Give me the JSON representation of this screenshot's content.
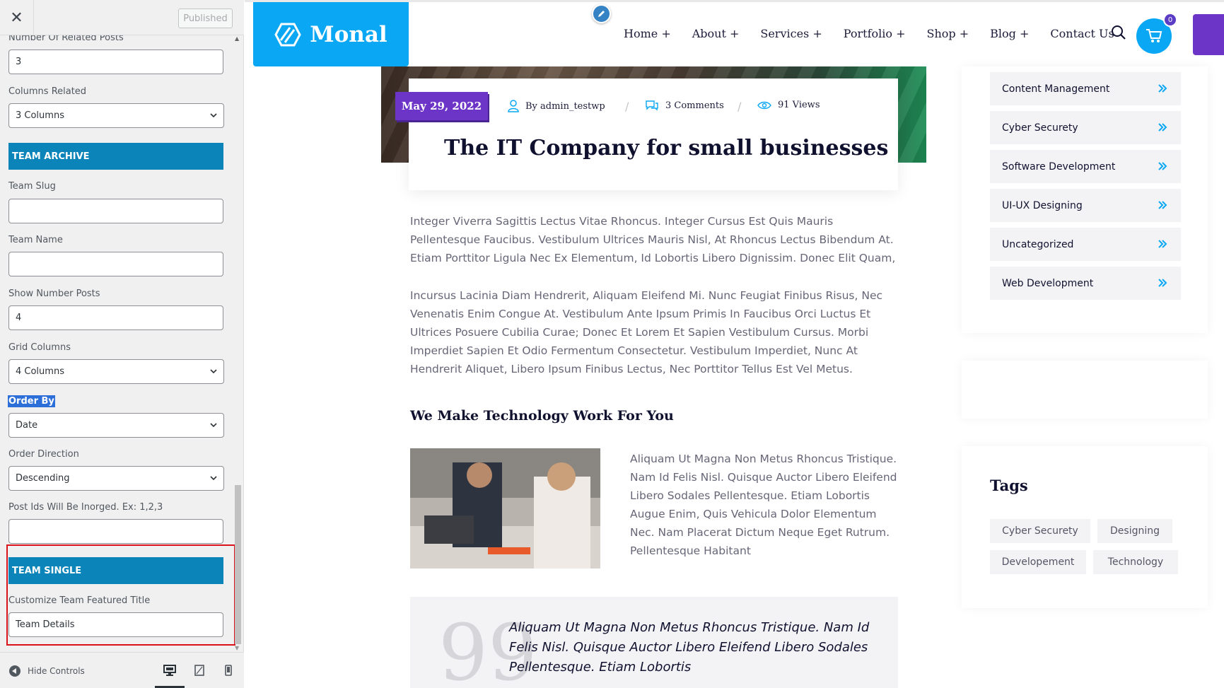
{
  "panel": {
    "close_glyph": "✕",
    "publish_label": "Published",
    "fields": {
      "related_posts_label": "Number Of Related Posts",
      "related_posts_value": "3",
      "columns_related_label": "Columns Related",
      "columns_related_value": "3 Columns",
      "team_archive_heading": "TEAM ARCHIVE",
      "team_slug_label": "Team Slug",
      "team_slug_value": "",
      "team_name_label": "Team Name",
      "team_name_value": "",
      "show_number_posts_label": "Show Number Posts",
      "show_number_posts_value": "4",
      "grid_columns_label": "Grid Columns",
      "grid_columns_value": "4 Columns",
      "order_by_label": "Order By",
      "order_by_value": "Date",
      "order_direction_label": "Order Direction",
      "order_direction_value": "Descending",
      "post_ids_label": "Post Ids Will Be Inorged. Ex: 1,2,3",
      "post_ids_value": "",
      "team_single_heading": "TEAM SINGLE",
      "featured_title_label": "Customize Team Featured Title",
      "featured_title_value": "Team Details"
    },
    "footer": {
      "hide_controls_label": "Hide Controls"
    }
  },
  "site": {
    "brand": "Monal",
    "nav": [
      "Home +",
      "About +",
      "Services +",
      "Portfolio +",
      "Shop +",
      "Blog +",
      "Contact Us"
    ],
    "cart_count": "0",
    "post": {
      "date": "May 29, 2022",
      "author": "By admin_testwp",
      "comments": "3 Comments",
      "views": "91 Views",
      "title": "The IT Company for small businesses",
      "para1": "Integer Viverra Sagittis Lectus Vitae Rhoncus. Integer Cursus Est Quis Mauris Pellentesque Faucibus. Vestibulum Ultrices Mauris Nisl, At Rhoncus Lectus Bibendum At. Etiam Porttitor Ligula Nec Ex Elementum, Id Lobortis Libero Dignissim. Donec Elit Quam,",
      "para2": "Incursus Lacinia Diam Hendrerit, Aliquam Eleifend Mi. Nunc Feugiat Finibus Risus, Nec Venenatis Enim Congue At. Vestibulum Ante Ipsum Primis In Faucibus Orci Luctus Et Ultrices Posuere Cubilia Curae; Donec Et Lorem Et Sapien Vestibulum Cursus. Morbi Imperdiet Sapien Et Odio Fermentum Consectetur. Vestibulum Imperdiet, Nunc At Hendrerit Aliquet, Libero Ipsum Finibus Lectus, Nec Porttitor Tellus Est Vel Metus.",
      "subheading": "We Make Technology Work For You",
      "side_para": "Aliquam Ut Magna Non Metus Rhoncus Tristique. Nam Id Felis Nisl. Quisque Auctor Libero Eleifend Libero Sodales Pellentesque. Etiam Lobortis Augue Enim, Quis Vehicula Dolor Elementum Nec. Nam Placerat Dictum Neque Eget Rutrum. Pellentesque Habitant",
      "quote": "Aliquam Ut Magna Non Metus Rhoncus Tristique. Nam Id Felis Nisl. Quisque Auctor Libero Eleifend Libero Sodales Pellentesque. Etiam Lobortis"
    },
    "categories": [
      "Content Management",
      "Cyber Securety",
      "Software Development",
      "UI-UX Designing",
      "Uncategorized",
      "Web Development"
    ],
    "tags_title": "Tags",
    "tags": [
      "Cyber Securety",
      "Designing",
      "Developement",
      "Technology"
    ]
  },
  "colors": {
    "brand_blue": "#0aa7f5",
    "brand_purple": "#6c34c7",
    "section_blue": "#0a84b9",
    "highlight_red": "#d9121b"
  },
  "icons": {
    "close": "close-icon",
    "chevron": "chevron-down-icon",
    "hide_controls": "collapse-arrow-icon",
    "devices": [
      "desktop-icon",
      "tablet-icon",
      "mobile-icon"
    ],
    "logo": "monal-logo-icon",
    "edit": "pencil-icon",
    "search": "search-icon",
    "cart": "cart-icon",
    "meta": [
      "user-icon",
      "comments-icon",
      "eye-icon"
    ],
    "category_arrow": "double-chevron-right-icon"
  }
}
